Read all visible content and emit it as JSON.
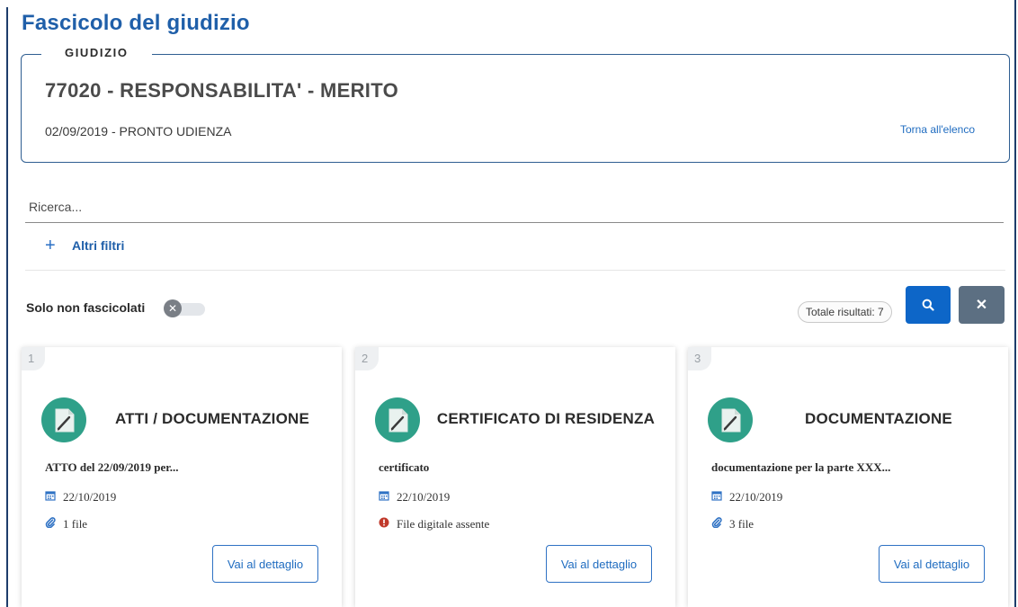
{
  "page_title": "Fascicolo del giudizio",
  "giudizio": {
    "legend": "GIUDIZIO",
    "title": "77020 - RESPONSABILITA' - MERITO",
    "subtitle": "02/09/2019 - PRONTO UDIENZA",
    "back_link": "Torna all'elenco"
  },
  "search": {
    "placeholder": "Ricerca...",
    "value": ""
  },
  "filters": {
    "label": "Altri filtri",
    "icon": "plus-icon"
  },
  "toggle": {
    "label": "Solo non fascicolati",
    "checked": false
  },
  "results": {
    "total_label": "Totale risultati: 7"
  },
  "buttons": {
    "search_icon": "search-icon",
    "clear_icon": "close-icon"
  },
  "colors": {
    "primary": "#0d66c8",
    "secondary": "#5c6f82",
    "title": "#1f5fa9",
    "card_icon_bg": "#2fa089",
    "error": "#c0392b"
  },
  "cards": [
    {
      "number": "1",
      "title": "ATTI / DOCUMENTAZIONE",
      "description": "ATTO del 22/09/2019 per...",
      "date": "22/10/2019",
      "files_text": "1 file",
      "files_icon": "paperclip-icon",
      "button_label": "Vai al dettaglio"
    },
    {
      "number": "2",
      "title": "CERTIFICATO DI RESIDENZA",
      "description": "certificato",
      "date": "22/10/2019",
      "files_text": "File digitale assente",
      "files_icon": "alert-icon",
      "button_label": "Vai al dettaglio"
    },
    {
      "number": "3",
      "title": "DOCUMENTAZIONE",
      "description": "documentazione per la parte XXX...",
      "date": "22/10/2019",
      "files_text": "3 file",
      "files_icon": "paperclip-icon",
      "button_label": "Vai al dettaglio"
    }
  ]
}
